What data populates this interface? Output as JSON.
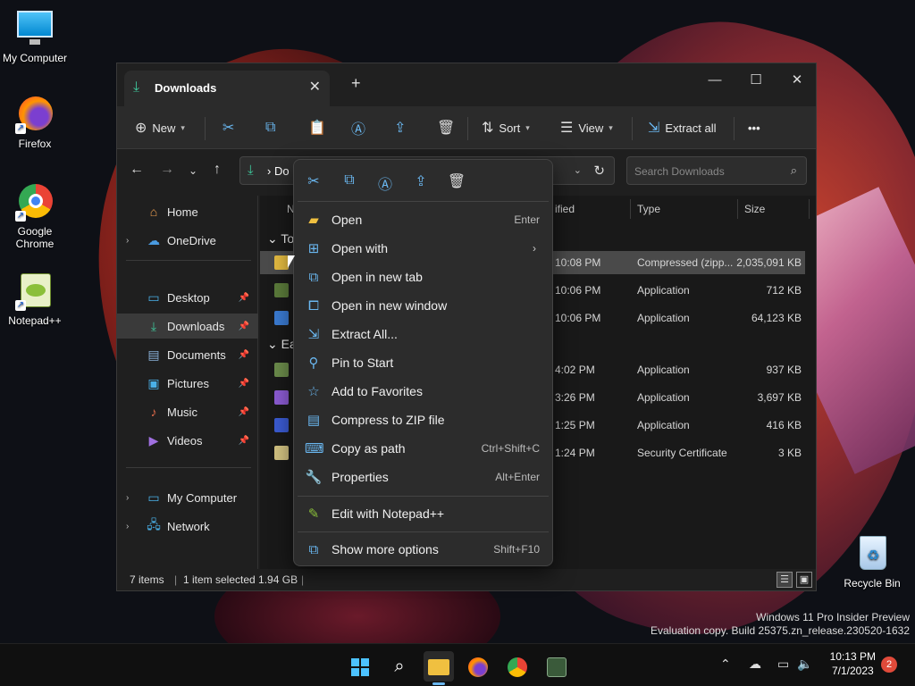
{
  "desktop": {
    "icons": [
      {
        "label": "My Computer",
        "icon": "monitor-icon"
      },
      {
        "label": "Firefox",
        "icon": "firefox-icon"
      },
      {
        "label": "Google Chrome",
        "icon": "chrome-icon"
      },
      {
        "label": "Notepad++",
        "icon": "notepadpp-icon"
      },
      {
        "label": "Recycle Bin",
        "icon": "recycle-bin-icon"
      }
    ],
    "watermark_line1": "Windows 11 Pro Insider Preview",
    "watermark_line2": "Evaluation copy. Build 25375.zn_release.230520-1632"
  },
  "explorer": {
    "tab_title": "Downloads",
    "toolbar": {
      "new_label": "New",
      "sort_label": "Sort",
      "view_label": "View",
      "extract_label": "Extract all",
      "more_label": "•••"
    },
    "address_text": "Do",
    "search_placeholder": "Search Downloads",
    "sidebar": {
      "home": "Home",
      "onedrive": "OneDrive",
      "desktop": "Desktop",
      "downloads": "Downloads",
      "documents": "Documents",
      "pictures": "Pictures",
      "music": "Music",
      "videos": "Videos",
      "mycomputer": "My Computer",
      "network": "Network"
    },
    "columns": {
      "name": "N",
      "modified": "ified",
      "type": "Type",
      "size": "Size"
    },
    "groups": {
      "today": "To",
      "earlier": "Ea"
    },
    "rows": [
      {
        "date": "10:08 PM",
        "type": "Compressed (zipp...",
        "size": "2,035,091 KB",
        "color": "#e0b840"
      },
      {
        "date": "10:06 PM",
        "type": "Application",
        "size": "712 KB",
        "color": "#5a7a3a"
      },
      {
        "date": "10:06 PM",
        "type": "Application",
        "size": "64,123 KB",
        "color": "#3a7ad0"
      },
      {
        "date": "4:02 PM",
        "type": "Application",
        "size": "937 KB",
        "color": "#6a8a4a"
      },
      {
        "date": "3:26 PM",
        "type": "Application",
        "size": "3,697 KB",
        "color": "#8a5ad0"
      },
      {
        "date": "1:25 PM",
        "type": "Application",
        "size": "416 KB",
        "color": "#3a5ad0"
      },
      {
        "date": "1:24 PM",
        "type": "Security Certificate",
        "size": "3 KB",
        "color": "#d0c080"
      }
    ],
    "status": {
      "items": "7 items",
      "selected": "1 item selected  1.94 GB"
    }
  },
  "context_menu": {
    "items": [
      {
        "label": "Open",
        "shortcut": "Enter",
        "icon": "folder-open-icon"
      },
      {
        "label": "Open with",
        "shortcut": "",
        "icon": "open-with-icon"
      },
      {
        "label": "Open in new tab",
        "shortcut": "",
        "icon": "new-tab-icon"
      },
      {
        "label": "Open in new window",
        "shortcut": "",
        "icon": "new-window-icon"
      },
      {
        "label": "Extract All...",
        "shortcut": "",
        "icon": "extract-icon"
      },
      {
        "label": "Pin to Start",
        "shortcut": "",
        "icon": "pin-icon"
      },
      {
        "label": "Add to Favorites",
        "shortcut": "",
        "icon": "star-icon"
      },
      {
        "label": "Compress to ZIP file",
        "shortcut": "",
        "icon": "zip-icon"
      },
      {
        "label": "Copy as path",
        "shortcut": "Ctrl+Shift+C",
        "icon": "copy-path-icon"
      },
      {
        "label": "Properties",
        "shortcut": "Alt+Enter",
        "icon": "wrench-icon"
      },
      {
        "label": "Edit with Notepad++",
        "shortcut": "",
        "icon": "notepadpp-icon"
      },
      {
        "label": "Show more options",
        "shortcut": "Shift+F10",
        "icon": "more-options-icon"
      }
    ]
  },
  "taskbar": {
    "time": "10:13 PM",
    "date": "7/1/2023",
    "notifications": "2"
  }
}
